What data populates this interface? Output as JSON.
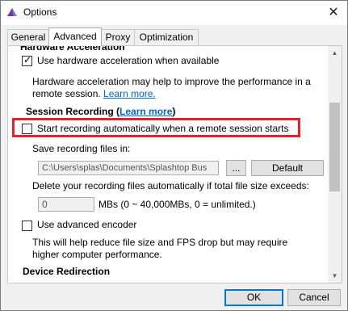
{
  "window": {
    "title": "Options",
    "close_glyph": "✕",
    "accent": "#6b3fa0"
  },
  "tabs": [
    "General",
    "Advanced",
    "Proxy",
    "Optimization"
  ],
  "content": {
    "cut_heading": "Hardware Acceleration",
    "hw_accel_label": "Use hardware acceleration when available",
    "hw_desc1": "Hardware acceleration may help to improve the performance in a",
    "hw_desc2": "remote session.",
    "learn_more": "Learn more.",
    "session_recording": "Session Recording (",
    "session_learn_more": "Learn more",
    "session_close": ")",
    "start_recording_label": "Start recording automatically when a remote session starts",
    "save_files_label": "Save recording files in:",
    "path_value": "C:\\Users\\splas\\Documents\\Splashtop Bus",
    "browse_label": "...",
    "default_label": "Default",
    "delete_label": "Delete your recording files automatically if total file size exceeds:",
    "size_value": "0",
    "mb_label": "MBs (0 ~ 40,000MBs, 0 = unlimited.)",
    "adv_encoder_label": "Use advanced encoder",
    "enc_desc1": "This will help reduce file size and FPS drop but may require",
    "enc_desc2": "higher computer performance.",
    "device_redirection": "Device Redirection"
  },
  "footer": {
    "ok": "OK",
    "cancel": "Cancel"
  },
  "highlight_color": "#e3212c",
  "checkbox_states": {
    "hardware_acceleration": true,
    "start_recording": false,
    "advanced_encoder": false
  }
}
